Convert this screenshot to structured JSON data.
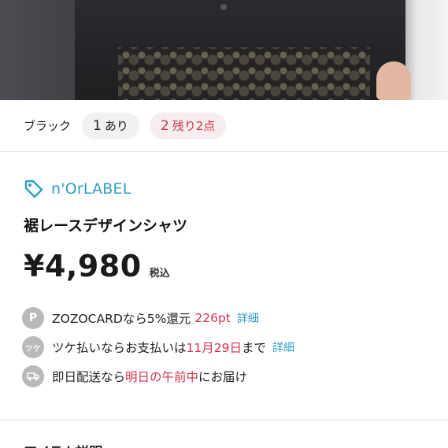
{
  "variant": {
    "color": "ブラック",
    "options": [
      {
        "num": "1",
        "label": "あり",
        "low_stock": false
      },
      {
        "num": "2",
        "label": "残り2点",
        "low_stock": true
      }
    ]
  },
  "product": {
    "brand": "n'OrLABEL",
    "title": "裾レースデザインシャツ",
    "price": "¥4,980",
    "tax_label": "税込"
  },
  "info": {
    "zozocard": {
      "icon_letter": "P",
      "text": "ZOZOCARDなら5%還元",
      "points": "226pt",
      "link": "詳細"
    },
    "tsuke": {
      "icon_glyph": "ツケ",
      "text_before": "ツケ払いならお支払いは",
      "date": "11月29日",
      "text_after": "まで",
      "link": "詳細"
    },
    "delivery": {
      "text_before": "即日配送なら",
      "highlight": "明日の午前中",
      "text_after": "にお届け"
    }
  },
  "next_section": {
    "heading": "アイテム説明"
  },
  "colors": {
    "accent": "#2f9ec0",
    "alert": "#d0344c",
    "icon_bg": "#b9b9b9"
  },
  "icons": {
    "brand": "tag-icon",
    "points": "point-icon",
    "tsuke": "deferred-payment-icon",
    "delivery": "truck-icon"
  }
}
